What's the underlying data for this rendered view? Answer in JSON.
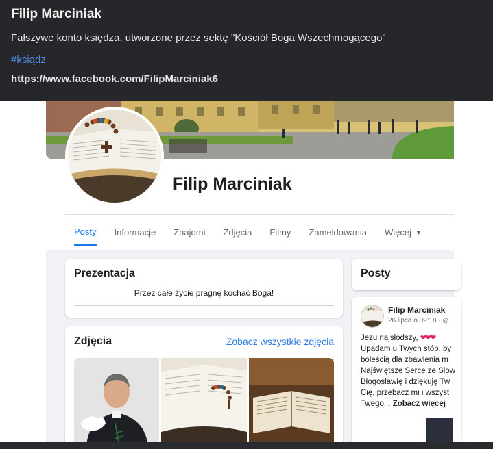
{
  "info": {
    "title": "Filip Marciniak",
    "description": "Fałszywe konto księdza, utworzone przez sektę \"Kościół Boga Wszechmogącego\"",
    "hashtag": "#ksiądz",
    "link": "https://www.facebook.com/FilipMarciniak6"
  },
  "profile": {
    "name": "Filip Marciniak"
  },
  "tabs": [
    {
      "label": "Posty"
    },
    {
      "label": "Informacje"
    },
    {
      "label": "Znajomi"
    },
    {
      "label": "Zdjęcia"
    },
    {
      "label": "Filmy"
    },
    {
      "label": "Zameldowania"
    },
    {
      "label": "Więcej"
    }
  ],
  "intro": {
    "heading": "Prezentacja",
    "bio": "Przez całe życie pragnę kochać Boga!"
  },
  "photos": {
    "heading": "Zdjęcia",
    "see_all": "Zobacz wszystkie zdjęcia"
  },
  "posts": {
    "heading": "Posty",
    "post": {
      "author": "Filip Marciniak",
      "meta": "26 lipca o 09:18 · ",
      "lines": [
        "Jezu najsłodszy,",
        "Upadam u Twych stóp, by",
        "boleścią dla zbawienia m",
        "Najświętsze Serce ze Słow",
        "Błogosławię i dziękuję Tw",
        "Cię, przebacz mi i wszyst",
        "Twego..."
      ],
      "see_more": "Zobacz więcej"
    }
  },
  "colors": {
    "accent": "#1877f2",
    "link": "#2d7be5",
    "hashtag": "#4b8be0",
    "panel": "#26272a"
  }
}
